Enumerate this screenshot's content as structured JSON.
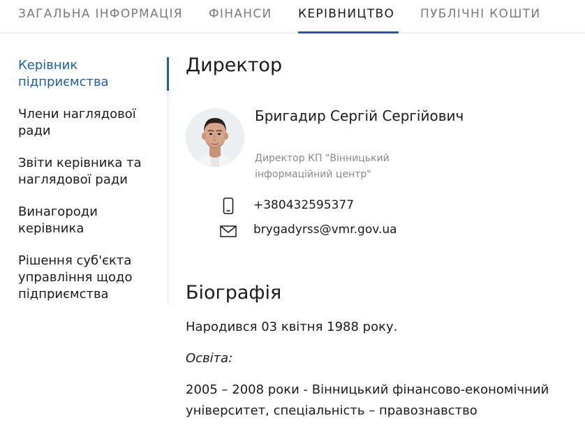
{
  "tabs": [
    {
      "label": "ЗАГАЛЬНА ІНФОРМАЦІЯ"
    },
    {
      "label": "ФІНАНСИ"
    },
    {
      "label": "КЕРІВНИЦТВО"
    },
    {
      "label": "ПУБЛІЧНІ КОШТИ"
    }
  ],
  "active_tab": "КЕРІВНИЦТВО",
  "sidebar": {
    "items": [
      {
        "label": "Керівник підприємства"
      },
      {
        "label": "Члени наглядової ради"
      },
      {
        "label": "Звіти керівника та наглядової ради"
      },
      {
        "label": "Винагороди керівника"
      },
      {
        "label": "Рішення суб'єкта управління щодо підприємства"
      }
    ],
    "active_item": "Керівник підприємства"
  },
  "director": {
    "heading": "Директор",
    "name": "Бригадир Сергій Сергійович",
    "role": "Директор КП \"Вінницький інформаційний центр\"",
    "phone": "+380432595377",
    "email": "brygadyrss@vmr.gov.ua"
  },
  "biography": {
    "heading": "Біографія",
    "born": "Народився 03 квітня 1988 року.",
    "education_label": "Освіта:",
    "education_item": "2005 – 2008 роки - Вінницький фінансово-економічний університет, спеціальність – правознавство"
  },
  "colors": {
    "accent": "#1d5fa6",
    "text": "#1a1a1a",
    "muted": "#8a8a8a",
    "divider": "#e1e1e1"
  },
  "icons": {
    "phone": "phone-icon",
    "email": "envelope-icon"
  }
}
